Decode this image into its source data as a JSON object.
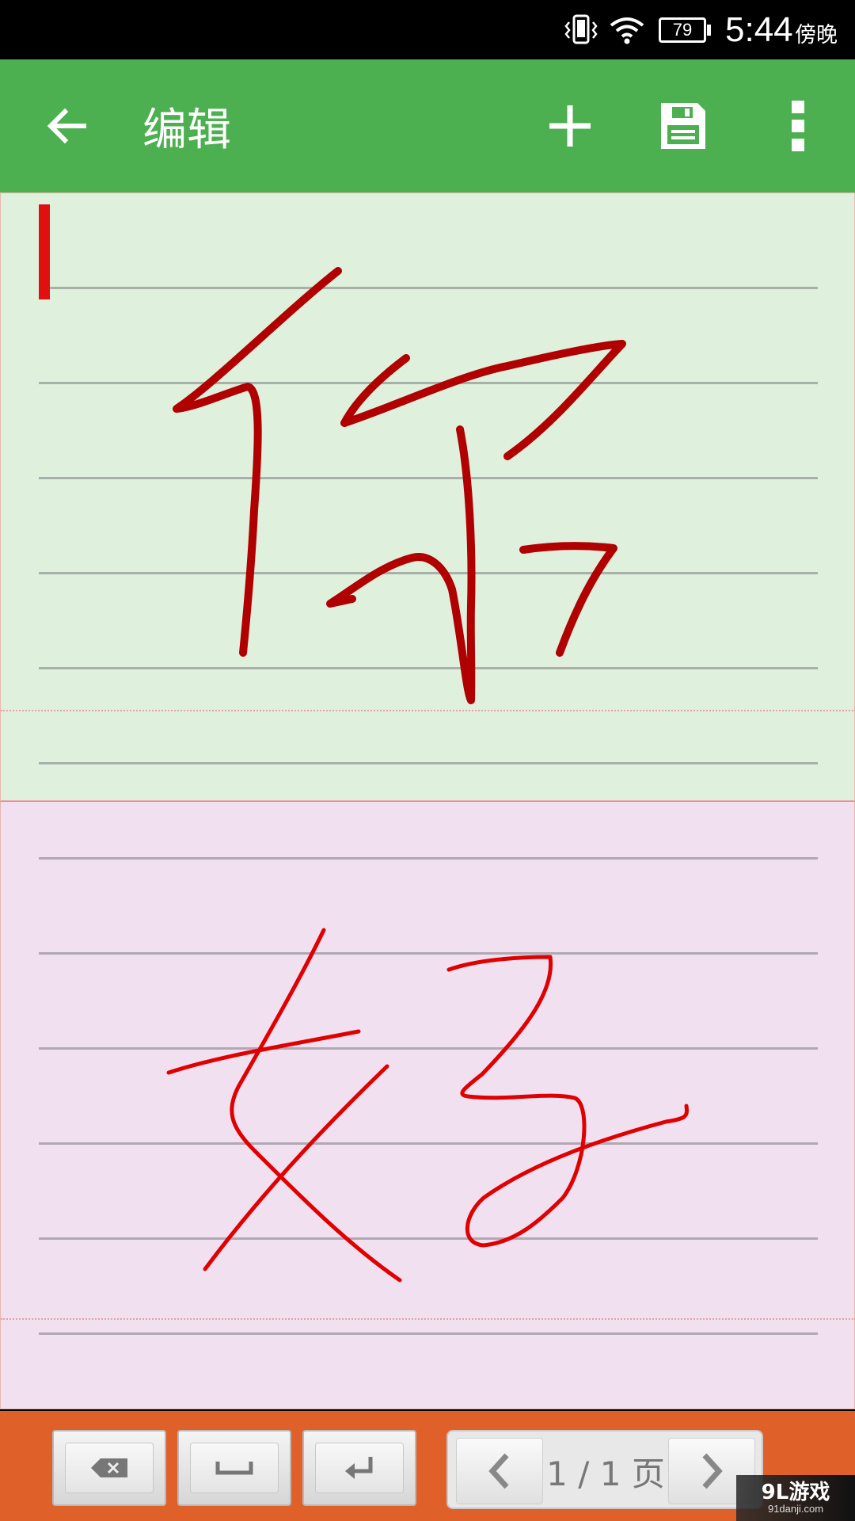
{
  "status_bar": {
    "time": "5:44",
    "period": "傍晚",
    "battery_level": "79"
  },
  "toolbar": {
    "title": "编辑",
    "back_icon": "arrow-left-icon",
    "add_icon": "plus-icon",
    "save_icon": "floppy-disk-icon",
    "more_icon": "more-vertical-icon",
    "color": "#4caf50"
  },
  "writing": {
    "upper_pad_color": "#dff0dd",
    "lower_pad_color": "#f0e0f0",
    "upper_stroke_color": "#b00000",
    "lower_stroke_color": "#e00000",
    "cursor_color": "#e01010"
  },
  "bottom_bar": {
    "color": "#e0602a",
    "backspace_icon": "backspace-icon",
    "space_icon": "space-icon",
    "enter_icon": "enter-icon",
    "prev_icon": "chevron-left-icon",
    "next_icon": "chevron-right-icon",
    "page_label": "1 / 1 页"
  },
  "watermark": {
    "main": "9L游戏",
    "sub": "91danji.com"
  }
}
